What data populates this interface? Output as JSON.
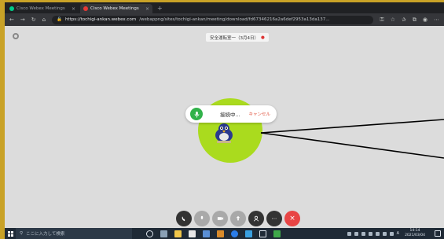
{
  "browser": {
    "tabs": [
      {
        "label": "Cisco Webex Meetings",
        "active": false
      },
      {
        "label": "Cisco Webex Meetings",
        "active": true
      }
    ],
    "new_tab": "+",
    "url_host": "https://tochigi-ankan.webex.com",
    "url_path": "/webappng/sites/tochigi-ankan/meeting/download/fd67346216a2a6def2953a13da137..."
  },
  "meeting": {
    "title": "安全運転室一（3月4日）",
    "recording_mark": "●",
    "status_text": "接続中...",
    "cancel_label": "キャンセル"
  },
  "taskbar": {
    "search_placeholder": "ここに入力して検索",
    "ime": "A",
    "time": "14:14",
    "date": "2021/03/04"
  },
  "colors": {
    "frame": "#c9a227",
    "avatar_bg": "#aadb1e",
    "mic_green": "#31b24a",
    "end_red": "#e84545",
    "cancel_red": "#e0513c"
  }
}
